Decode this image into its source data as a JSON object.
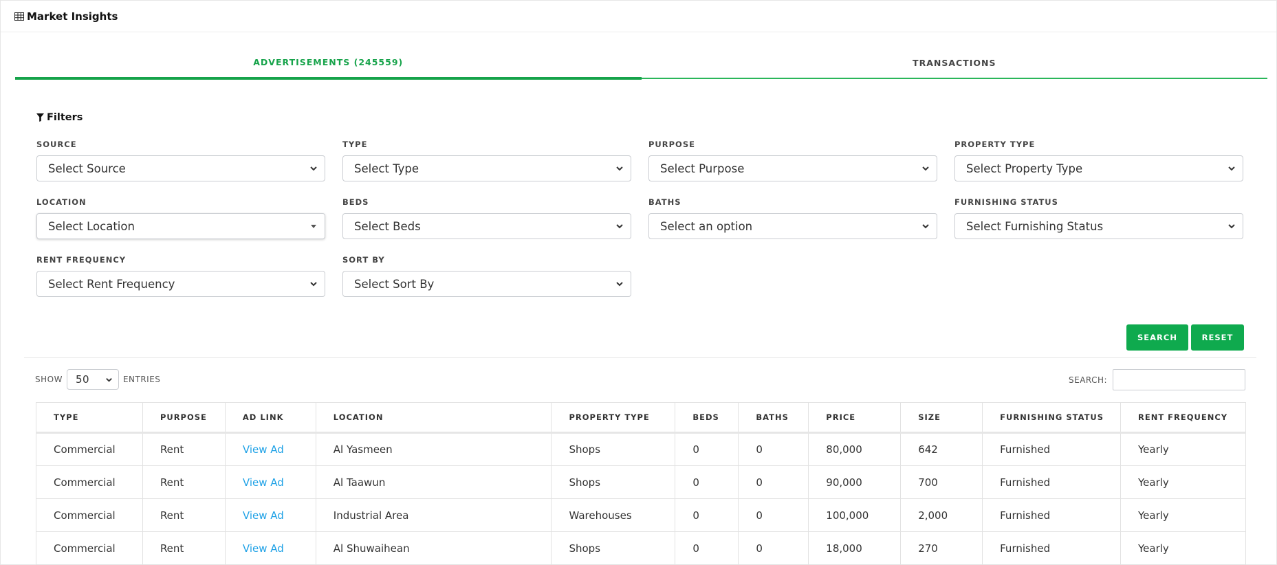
{
  "header": {
    "title": "Market Insights",
    "icon": "table-icon"
  },
  "tabs": [
    {
      "label": "ADVERTISEMENTS (245559)",
      "active": true
    },
    {
      "label": "TRANSACTIONS",
      "active": false
    }
  ],
  "filters": {
    "title": "Filters",
    "fields": [
      {
        "label": "SOURCE",
        "value": "Select Source"
      },
      {
        "label": "TYPE",
        "value": "Select Type"
      },
      {
        "label": "PURPOSE",
        "value": "Select Purpose"
      },
      {
        "label": "PROPERTY TYPE",
        "value": "Select Property Type"
      },
      {
        "label": "LOCATION",
        "value": "Select Location"
      },
      {
        "label": "BEDS",
        "value": "Select Beds"
      },
      {
        "label": "BATHS",
        "value": "Select an option"
      },
      {
        "label": "FURNISHING STATUS",
        "value": "Select Furnishing Status"
      },
      {
        "label": "RENT FREQUENCY",
        "value": "Select Rent Frequency"
      },
      {
        "label": "SORT BY",
        "value": "Select Sort By"
      }
    ],
    "search_label": "SEARCH",
    "reset_label": "RESET"
  },
  "table_controls": {
    "show_label": "SHOW",
    "entries_value": "50",
    "entries_label": "ENTRIES",
    "search_label": "SEARCH:"
  },
  "table": {
    "columns": [
      "TYPE",
      "PURPOSE",
      "AD LINK",
      "LOCATION",
      "PROPERTY TYPE",
      "BEDS",
      "BATHS",
      "PRICE",
      "SIZE",
      "FURNISHING STATUS",
      "RENT FREQUENCY"
    ],
    "rows": [
      [
        "Commercial",
        "Rent",
        "View Ad",
        "Al Yasmeen",
        "Shops",
        "0",
        "0",
        "80,000",
        "642",
        "Furnished",
        "Yearly"
      ],
      [
        "Commercial",
        "Rent",
        "View Ad",
        "Al Taawun",
        "Shops",
        "0",
        "0",
        "90,000",
        "700",
        "Furnished",
        "Yearly"
      ],
      [
        "Commercial",
        "Rent",
        "View Ad",
        "Industrial Area",
        "Warehouses",
        "0",
        "0",
        "100,000",
        "2,000",
        "Furnished",
        "Yearly"
      ],
      [
        "Commercial",
        "Rent",
        "View Ad",
        "Al Shuwaihean",
        "Shops",
        "0",
        "0",
        "18,000",
        "270",
        "Furnished",
        "Yearly"
      ]
    ]
  },
  "colors": {
    "accent": "#16a34a",
    "button": "#0faa4e",
    "link": "#1ea1e6"
  }
}
